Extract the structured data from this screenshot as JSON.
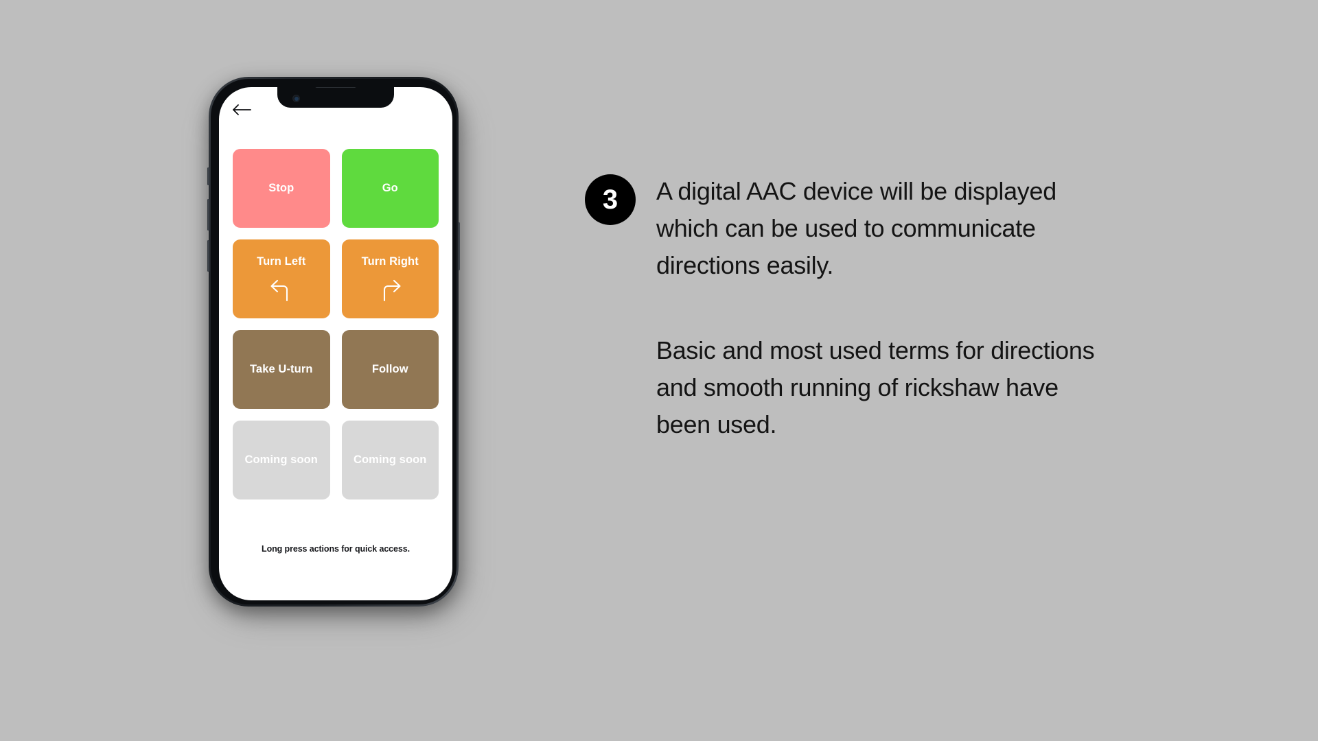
{
  "page": {
    "background_color": "#bebebe"
  },
  "phone": {
    "frame_color": "#16191d",
    "screen_background": "#ffffff",
    "notch": {
      "camera_icon": "front-camera-icon",
      "speaker_icon": "earpiece-speaker-icon"
    },
    "hardware_buttons": [
      "silent-switch",
      "volume-up-button",
      "volume-down-button",
      "power-button"
    ]
  },
  "app": {
    "back_button": {
      "icon": "arrow-left-icon",
      "label": ""
    },
    "tiles": [
      {
        "label": "Stop",
        "color": "#ff8a8a",
        "text_color": "#ffffff",
        "icon": null,
        "disabled": false
      },
      {
        "label": "Go",
        "color": "#5fda3e",
        "text_color": "#ffffff",
        "icon": null,
        "disabled": false
      },
      {
        "label": "Turn Left",
        "color": "#ec9839",
        "text_color": "#ffffff",
        "icon": "arrow-turn-left-icon",
        "disabled": false
      },
      {
        "label": "Turn Right",
        "color": "#ec9839",
        "text_color": "#ffffff",
        "icon": "arrow-turn-right-icon",
        "disabled": false
      },
      {
        "label": "Take U-turn",
        "color": "#917754",
        "text_color": "#ffffff",
        "icon": null,
        "disabled": false
      },
      {
        "label": "Follow",
        "color": "#917754",
        "text_color": "#ffffff",
        "icon": null,
        "disabled": false
      },
      {
        "label": "Coming soon",
        "color": "#d8d8d8",
        "text_color": "#ffffff",
        "icon": null,
        "disabled": true
      },
      {
        "label": "Coming soon",
        "color": "#d8d8d8",
        "text_color": "#ffffff",
        "icon": null,
        "disabled": true
      }
    ],
    "footer_note": "Long press actions for quick access."
  },
  "annotation": {
    "step_number": "3",
    "paragraph_1": "A digital AAC device will be displayed which can be used to communicate directions easily.",
    "paragraph_2": "Basic and most used terms for directions and smooth running of rickshaw have been used.",
    "text_color": "#141414",
    "badge_color": "#000000"
  }
}
